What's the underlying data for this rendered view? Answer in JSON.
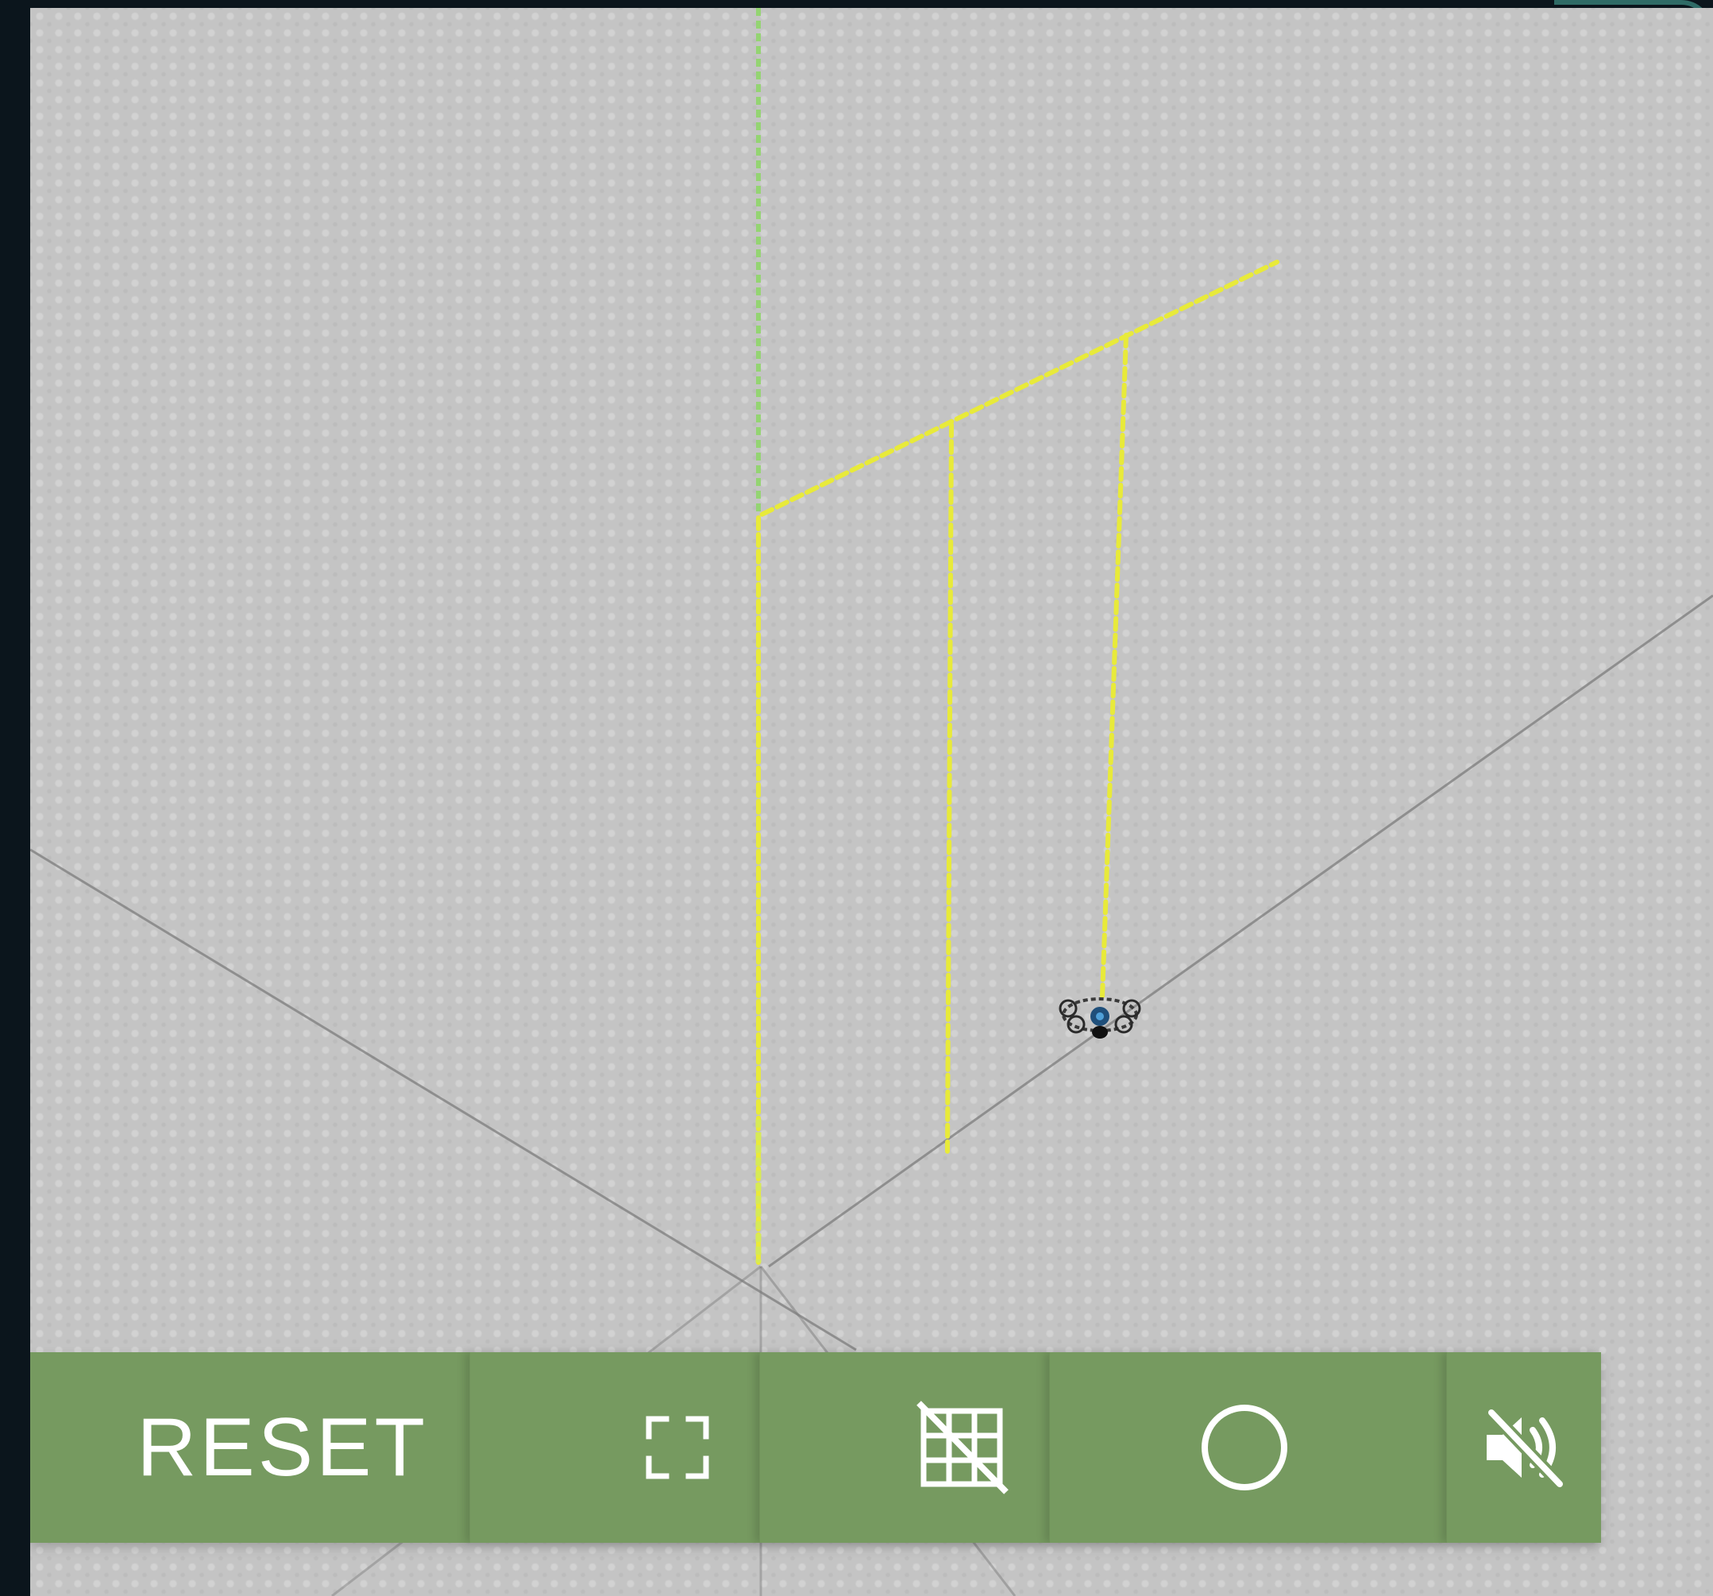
{
  "viewport": {
    "scene": "3d-drone-flight-view",
    "colors": {
      "ground": "#c4c4c4",
      "path": "#e8ea3a",
      "axis_vertical": "#8fd66a",
      "axis_lines": "#7d7d7d",
      "toolbar": "#769a60"
    }
  },
  "toolbar": {
    "reset_label": "RESET",
    "fullscreen_icon": "fullscreen-icon",
    "grid_icon": "grid-off-icon",
    "record_icon": "circle-icon",
    "mute_icon": "volume-off-icon"
  }
}
